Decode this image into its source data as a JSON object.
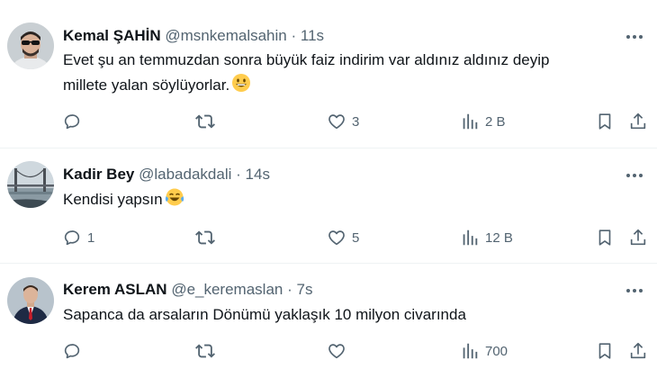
{
  "tweets": [
    {
      "name": "Kemal ŞAHİN",
      "handle": "@msnkemalsahin",
      "dot": "·",
      "time": "11s",
      "text_line1": "Evet şu an temmuzdan sonra büyük faiz indirim var aldınız aldınız deyip",
      "text_line2": "millete yalan söylüyorlar.",
      "emoji": "smiling-face-emoji",
      "replies": "",
      "retweets": "",
      "likes": "3",
      "views": "2 B"
    },
    {
      "name": "Kadir Bey",
      "handle": "@labadakdali",
      "dot": "·",
      "time": "14s",
      "text_line1": "Kendisi yapsın",
      "emoji": "tears-of-joy-emoji",
      "replies": "1",
      "retweets": "",
      "likes": "5",
      "views": "12 B"
    },
    {
      "name": "Kerem ASLAN",
      "handle": "@e_keremaslan",
      "dot": "·",
      "time": "7s",
      "text_line1": "Sapanca da arsaların Dönümü yaklaşık 10 milyon civarında",
      "replies": "",
      "retweets": "",
      "likes": "",
      "views": "700"
    }
  ],
  "colors": {
    "text": "#0f1419",
    "secondary": "#536471",
    "divider": "#eff3f4"
  }
}
